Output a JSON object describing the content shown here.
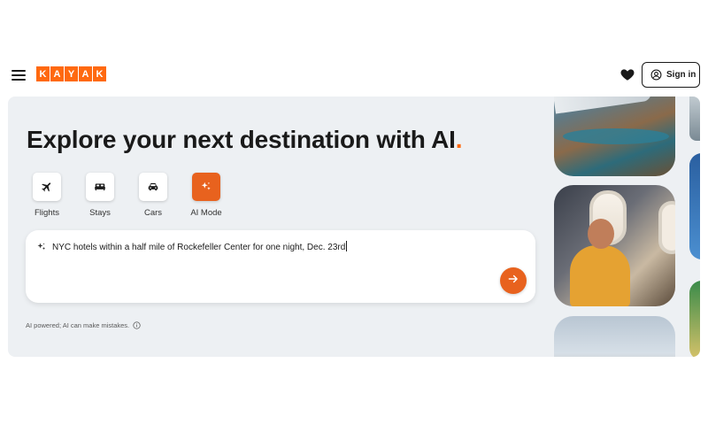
{
  "header": {
    "menu_icon": "hamburger-menu-icon",
    "logo_letters": [
      "K",
      "A",
      "Y",
      "A",
      "K"
    ],
    "favorites_icon": "heart-icon",
    "signin_label": "Sign in",
    "signin_icon": "user-circle-icon"
  },
  "hero": {
    "headline": "Explore your next destination with AI",
    "headline_dot": ".",
    "verticals": [
      {
        "label": "Flights",
        "icon": "airplane-icon",
        "active": false
      },
      {
        "label": "Stays",
        "icon": "bed-icon",
        "active": false
      },
      {
        "label": "Cars",
        "icon": "car-icon",
        "active": false
      },
      {
        "label": "AI Mode",
        "icon": "sparkle-icon",
        "active": true
      }
    ],
    "search": {
      "query": "NYC hotels within a half mile of Rockefeller Center for one night, Dec. 23rd",
      "icon": "sparkle-icon",
      "submit_icon": "arrow-right-icon"
    },
    "disclaimer": "AI powered; AI can make mistakes.",
    "disclaimer_icon": "info-icon"
  },
  "colors": {
    "brand": "#ff690f",
    "accent": "#e8621e",
    "hero_bg": "#edf0f3"
  }
}
